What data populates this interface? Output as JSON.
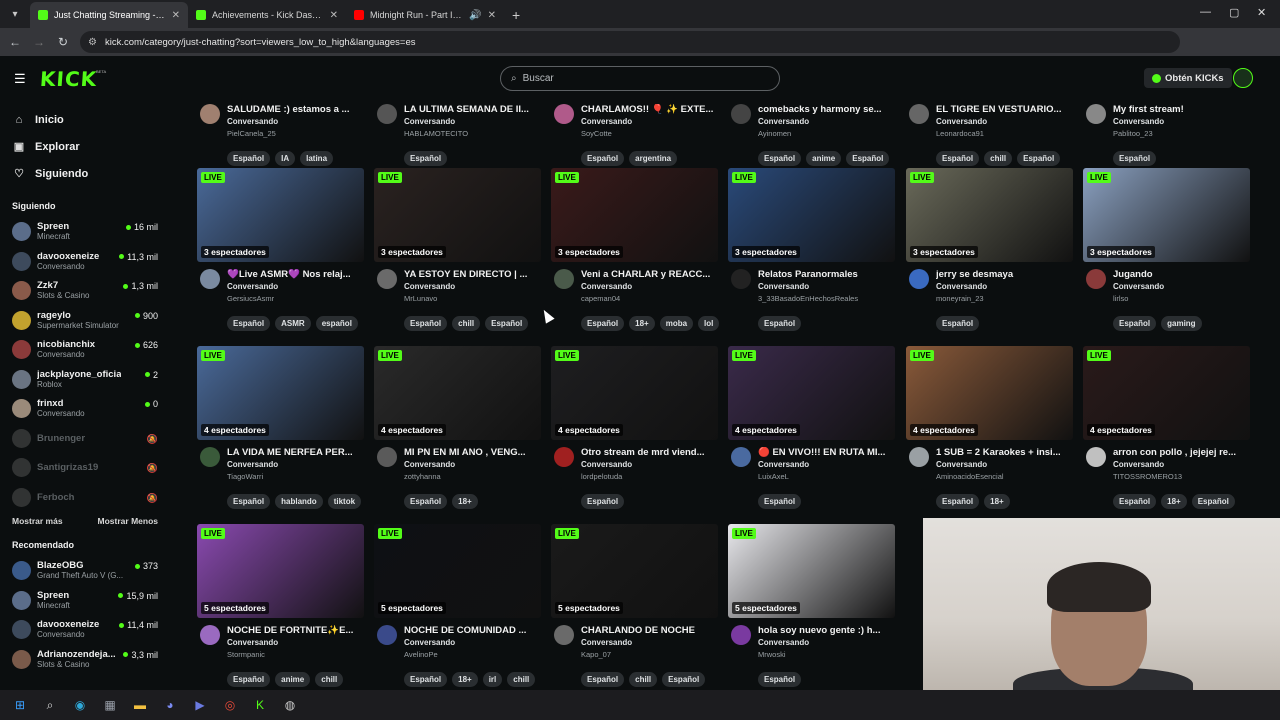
{
  "browser": {
    "tabs": [
      {
        "title": "Just Chatting Streaming - Live S",
        "active": true,
        "favicon_color": "#53fc18"
      },
      {
        "title": "Achievements - Kick Dashboard",
        "active": false,
        "favicon_color": "#53fc18"
      },
      {
        "title": "Midnight Run - Part II (R34",
        "active": false,
        "favicon_color": "#ff0000"
      }
    ],
    "url": "kick.com/category/just-chatting?sort=viewers_low_to_high&languages=es"
  },
  "header": {
    "logo": "KICK",
    "beta": "BETA",
    "search_placeholder": "Buscar",
    "kicks_button": "Obtén KICKs"
  },
  "sidebar": {
    "nav": [
      {
        "label": "Inicio",
        "icon": "home-icon"
      },
      {
        "label": "Explorar",
        "icon": "compass-icon"
      },
      {
        "label": "Siguiendo",
        "icon": "heart-icon"
      }
    ],
    "following_title": "Siguiendo",
    "following": [
      {
        "name": "Spreen",
        "category": "Minecraft",
        "viewers": "16 mil",
        "color": "#5b6d8a",
        "online": true
      },
      {
        "name": "davooxeneize",
        "category": "Conversando",
        "viewers": "11,3 mil",
        "color": "#3d4a5c",
        "online": true
      },
      {
        "name": "Zzk7",
        "category": "Slots & Casino",
        "viewers": "1,3 mil",
        "color": "#8a5a4a",
        "online": true
      },
      {
        "name": "rageylo",
        "category": "Supermarket Simulator",
        "viewers": "900",
        "color": "#c2a22e",
        "online": true
      },
      {
        "name": "nicobianchix",
        "category": "Conversando",
        "viewers": "626",
        "color": "#8b3a3a",
        "online": true
      },
      {
        "name": "jackplayone_oficial",
        "category": "Roblox",
        "viewers": "2",
        "color": "#6a7482",
        "online": true
      },
      {
        "name": "frinxd",
        "category": "Conversando",
        "viewers": "0",
        "color": "#9a8a7a",
        "online": true
      },
      {
        "name": "Brunenger",
        "category": "",
        "viewers": "",
        "color": "#777",
        "online": false
      },
      {
        "name": "Santigrizas19",
        "category": "",
        "viewers": "",
        "color": "#777",
        "online": false
      },
      {
        "name": "Ferboch",
        "category": "",
        "viewers": "",
        "color": "#777",
        "online": false
      }
    ],
    "show_more": "Mostrar más",
    "show_less": "Mostrar Menos",
    "recommended_title": "Recomendado",
    "recommended": [
      {
        "name": "BlazeOBG",
        "category": "Grand Theft Auto V (G...",
        "viewers": "373",
        "color": "#3a5a8a"
      },
      {
        "name": "Spreen",
        "category": "Minecraft",
        "viewers": "15,9 mil",
        "color": "#5b6d8a"
      },
      {
        "name": "davooxeneize",
        "category": "Conversando",
        "viewers": "11,4 mil",
        "color": "#3d4a5c"
      },
      {
        "name": "Adrianozendeja...",
        "category": "Slots & Casino",
        "viewers": "3,3 mil",
        "color": "#7a5a4a"
      }
    ]
  },
  "streams": [
    {
      "title": "SALUDAME :) estamos a ...",
      "category": "Conversando",
      "name": "PielCanela_25",
      "viewers": "",
      "tags": [
        "Español",
        "IA",
        "latina"
      ],
      "thumb": "#5a4a4a",
      "avatar": "#a08070"
    },
    {
      "title": "LA ULTIMA SEMANA DE II...",
      "category": "Conversando",
      "name": "HABLAMOTECITO",
      "viewers": "",
      "tags": [
        "Español"
      ],
      "thumb": "#3a3a4a",
      "avatar": "#555"
    },
    {
      "title": "CHARLAMOS!! 🎈 ✨ EXTE...",
      "category": "Conversando",
      "name": "SoyCotte",
      "viewers": "",
      "tags": [
        "Español",
        "argentina"
      ],
      "thumb": "#6a3a5a",
      "avatar": "#b05a8a"
    },
    {
      "title": "comebacks y harmony se...",
      "category": "Conversando",
      "name": "Ayinomen",
      "viewers": "",
      "tags": [
        "Español",
        "anime",
        "Español"
      ],
      "thumb": "#2a3a5a",
      "avatar": "#444"
    },
    {
      "title": "EL TIGRE EN VESTUARIO...",
      "category": "Conversando",
      "name": "Leonardoca91",
      "viewers": "",
      "tags": [
        "Español",
        "chill",
        "Español"
      ],
      "thumb": "#4a4a3a",
      "avatar": "#666"
    },
    {
      "title": "My first stream!",
      "category": "Conversando",
      "name": "Pablitoo_23",
      "viewers": "",
      "tags": [
        "Español"
      ],
      "thumb": "#3a4a4a",
      "avatar": "#888"
    },
    {
      "title": "💜Live ASMR💜 Nos relaj...",
      "category": "Conversando",
      "name": "GersiucsAsmr",
      "viewers": "3 espectadores",
      "tags": [
        "Español",
        "ASMR",
        "español"
      ],
      "thumb": "#4a6a9a",
      "avatar": "#7a8aa0"
    },
    {
      "title": "YA ESTOY EN DIRECTO | ...",
      "category": "Conversando",
      "name": "MrLunavo",
      "viewers": "3 espectadores",
      "tags": [
        "Español",
        "chill",
        "Español"
      ],
      "thumb": "#2a2220",
      "avatar": "#6a6a6a"
    },
    {
      "title": "Veni a CHARLAR y REACC...",
      "category": "Conversando",
      "name": "capeman04",
      "viewers": "3 espectadores",
      "tags": [
        "Español",
        "18+",
        "moba",
        "lol"
      ],
      "thumb": "#3a1a1a",
      "avatar": "#4a5a4a"
    },
    {
      "title": "Relatos Paranormales",
      "category": "Conversando",
      "name": "3_33BasadoEnHechosReales",
      "viewers": "3 espectadores",
      "tags": [
        "Español"
      ],
      "thumb": "#2a4a7a",
      "avatar": "#222"
    },
    {
      "title": "jerry se desmaya",
      "category": "Conversando",
      "name": "moneyrain_23",
      "viewers": "3 espectadores",
      "tags": [
        "Español"
      ],
      "thumb": "#6a6a5a",
      "avatar": "#3a6ac0"
    },
    {
      "title": "Jugando",
      "category": "Conversando",
      "name": "lirlso",
      "viewers": "3 espectadores",
      "tags": [
        "Español",
        "gaming"
      ],
      "thumb": "#8aa0c0",
      "avatar": "#8a3a3a"
    },
    {
      "title": "LA VIDA ME NERFEA PER...",
      "category": "Conversando",
      "name": "TiagoWarri",
      "viewers": "4 espectadores",
      "tags": [
        "Español",
        "hablando",
        "tiktok"
      ],
      "thumb": "#4a6a9a",
      "avatar": "#3a5a3a"
    },
    {
      "title": "MI PN EN MI ANO , VENG...",
      "category": "Conversando",
      "name": "zottyhanna",
      "viewers": "4 espectadores",
      "tags": [
        "Español",
        "18+"
      ],
      "thumb": "#2a2a2a",
      "avatar": "#5a5a5a"
    },
    {
      "title": "Otro stream de mrd viend...",
      "category": "Conversando",
      "name": "lordpelotuda",
      "viewers": "4 espectadores",
      "tags": [
        "Español"
      ],
      "thumb": "#1e1e20",
      "avatar": "#a02020"
    },
    {
      "title": "🔴 EN VIVO!!! EN RUTA MI...",
      "category": "Conversando",
      "name": "LuixAxeL",
      "viewers": "4 espectadores",
      "tags": [
        "Español"
      ],
      "thumb": "#3a2a4a",
      "avatar": "#4a6aa0"
    },
    {
      "title": "1 SUB = 2 Karaokes + insi...",
      "category": "Conversando",
      "name": "AminoacidoEsencial",
      "viewers": "4 espectadores",
      "tags": [
        "Español",
        "18+"
      ],
      "thumb": "#8a5a3a",
      "avatar": "#9aa0a4"
    },
    {
      "title": "arron con pollo , jejejej re...",
      "category": "Conversando",
      "name": "TITOSSROMERO13",
      "viewers": "4 espectadores",
      "tags": [
        "Español",
        "18+",
        "Español"
      ],
      "thumb": "#2a1a1a",
      "avatar": "#c0c0c0"
    },
    {
      "title": "NOCHE DE FORTNITE✨E...",
      "category": "Conversando",
      "name": "Stormpanic",
      "viewers": "5 espectadores",
      "tags": [
        "Español",
        "anime",
        "chill"
      ],
      "thumb": "#8a4ab0",
      "avatar": "#9a6ac0"
    },
    {
      "title": "NOCHE DE COMUNIDAD ...",
      "category": "Conversando",
      "name": "AvelinoPe",
      "viewers": "5 espectadores",
      "tags": [
        "Español",
        "18+",
        "irl",
        "chill"
      ],
      "thumb": "#0e1014",
      "avatar": "#3a4a8a"
    },
    {
      "title": "CHARLANDO DE NOCHE",
      "category": "Conversando",
      "name": "Kapo_07",
      "viewers": "5 espectadores",
      "tags": [
        "Español",
        "chill",
        "Español"
      ],
      "thumb": "#1a1a1a",
      "avatar": "#6a6a6a"
    },
    {
      "title": "hola soy nuevo gente :) h...",
      "category": "Conversando",
      "name": "Mrwoski",
      "viewers": "5 espectadores",
      "tags": [
        "Español"
      ],
      "thumb": "#e8e8ec",
      "avatar": "#7a3aa0"
    }
  ],
  "taskbar": [
    {
      "icon": "windows-icon",
      "color": "#3aa0ff"
    },
    {
      "icon": "search-icon",
      "color": "#ddd"
    },
    {
      "icon": "edge-icon",
      "color": "#2fa8d8"
    },
    {
      "icon": "calculator-icon",
      "color": "#9aa0aa"
    },
    {
      "icon": "folder-icon",
      "color": "#f2c040"
    },
    {
      "icon": "discord-icon",
      "color": "#7a8af0"
    },
    {
      "icon": "video-editor-icon",
      "color": "#6a7ae0"
    },
    {
      "icon": "chrome-icon",
      "color": "#e84a3a"
    },
    {
      "icon": "kick-app-icon",
      "color": "#53fc18"
    },
    {
      "icon": "obs-icon",
      "color": "#ccc"
    }
  ]
}
